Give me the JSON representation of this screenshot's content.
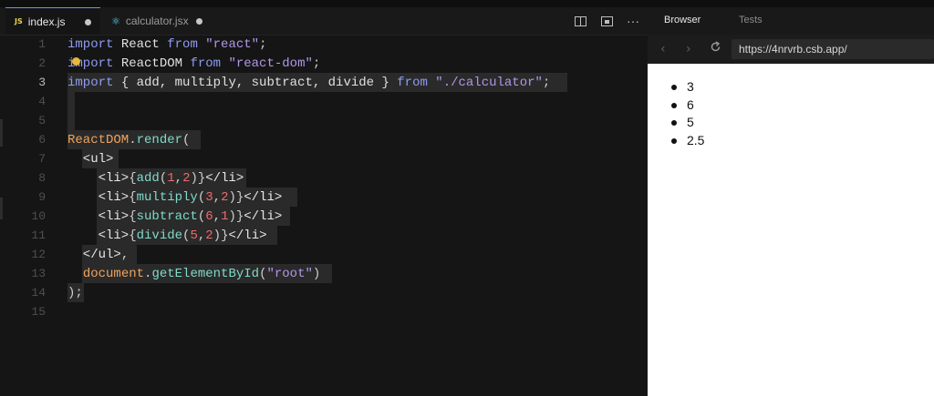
{
  "editor": {
    "tabs": [
      {
        "icon": "JS",
        "label": "index.js",
        "modified": true
      },
      {
        "icon": "⚛",
        "label": "calculator.jsx",
        "modified": true
      }
    ],
    "line_numbers": [
      "1",
      "2",
      "3",
      "4",
      "5",
      "6",
      "7",
      "8",
      "9",
      "10",
      "11",
      "12",
      "13",
      "14",
      "15"
    ],
    "current_line": 3
  },
  "preview": {
    "tabs": [
      "Browser",
      "Tests"
    ],
    "url": "https://4nrvrb.csb.app/",
    "output": [
      "3",
      "6",
      "5",
      "2.5"
    ]
  },
  "code": {
    "l1": [
      "import",
      " React ",
      "from",
      " ",
      "\"react\"",
      ";"
    ],
    "l2": [
      "import",
      " ReactDOM ",
      "from",
      " ",
      "\"react-dom\"",
      ";"
    ],
    "l3": [
      "import",
      " { add, multiply, subtract, divide } ",
      "from",
      " ",
      "\"./calculator\"",
      ";"
    ],
    "l6": [
      "ReactDOM",
      ".",
      "render",
      "("
    ],
    "l7": [
      "  <ul>"
    ],
    "l8": [
      "    <li>",
      "{",
      "add",
      "(",
      "1",
      ",",
      "2",
      ")",
      "}",
      "</li>"
    ],
    "l9": [
      "    <li>",
      "{",
      "multiply",
      "(",
      "3",
      ",",
      "2",
      ")",
      "}",
      "</li>"
    ],
    "l10": [
      "    <li>",
      "{",
      "subtract",
      "(",
      "6",
      ",",
      "1",
      ")",
      "}",
      "</li>"
    ],
    "l11": [
      "    <li>",
      "{",
      "divide",
      "(",
      "5",
      ",",
      "2",
      ")",
      "}",
      "</li>"
    ],
    "l12": [
      "  </ul>",
      ","
    ],
    "l13": [
      "  ",
      "document",
      ".",
      "getElementById",
      "(",
      "\"root\"",
      ")"
    ],
    "l14": [
      ");"
    ]
  }
}
